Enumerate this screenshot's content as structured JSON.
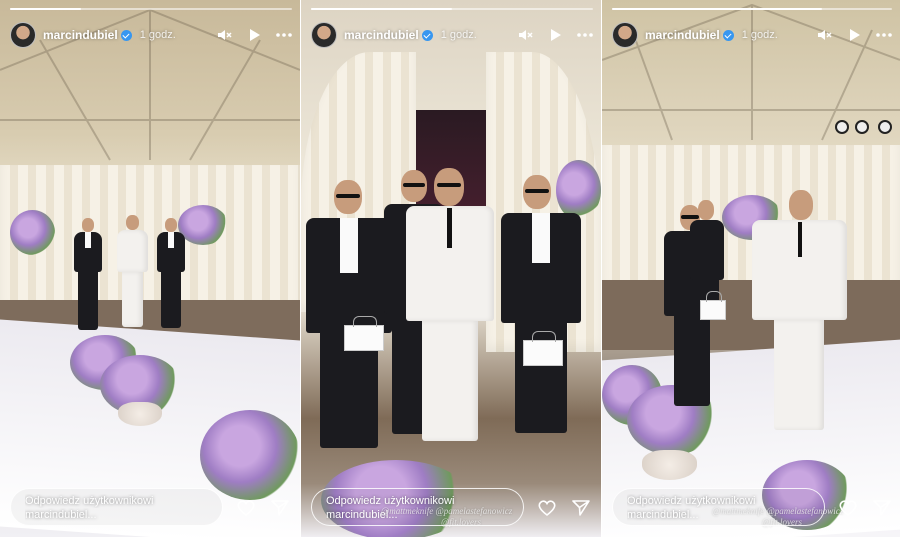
{
  "stories": [
    {
      "username": "marcindubiel",
      "time": "1 godz.",
      "progress": 0.25,
      "reply_placeholder_line1": "Odpowiedz użytkownikowi",
      "reply_placeholder_line2": "marcindubiel...",
      "tags": ""
    },
    {
      "username": "marcindubiel",
      "time": "1 godz.",
      "progress": 0.5,
      "reply_placeholder_line1": "Odpowiedz użytkownikowi",
      "reply_placeholder_line2": "marcindubiel...",
      "tags": "@mattmeknife @pamelastefanowicz",
      "tags2": "@fit.lovers"
    },
    {
      "username": "marcindubiel",
      "time": "1 godz.",
      "progress": 0.75,
      "reply_placeholder_line1": "Odpowiedz użytkownikowi",
      "reply_placeholder_line2": "marcindubiel...",
      "tags": "@mattmeknife @pamelastefanowicz",
      "tags2": "@fit.lovers"
    }
  ],
  "icons": {
    "mute": "speaker-muted-icon",
    "play": "play-icon",
    "more": "more-dots-icon",
    "like": "heart-icon",
    "share": "send-icon",
    "verified": "verified-badge-icon"
  },
  "colors": {
    "verified": "#3897f0",
    "overlay_text": "#ffffff"
  }
}
